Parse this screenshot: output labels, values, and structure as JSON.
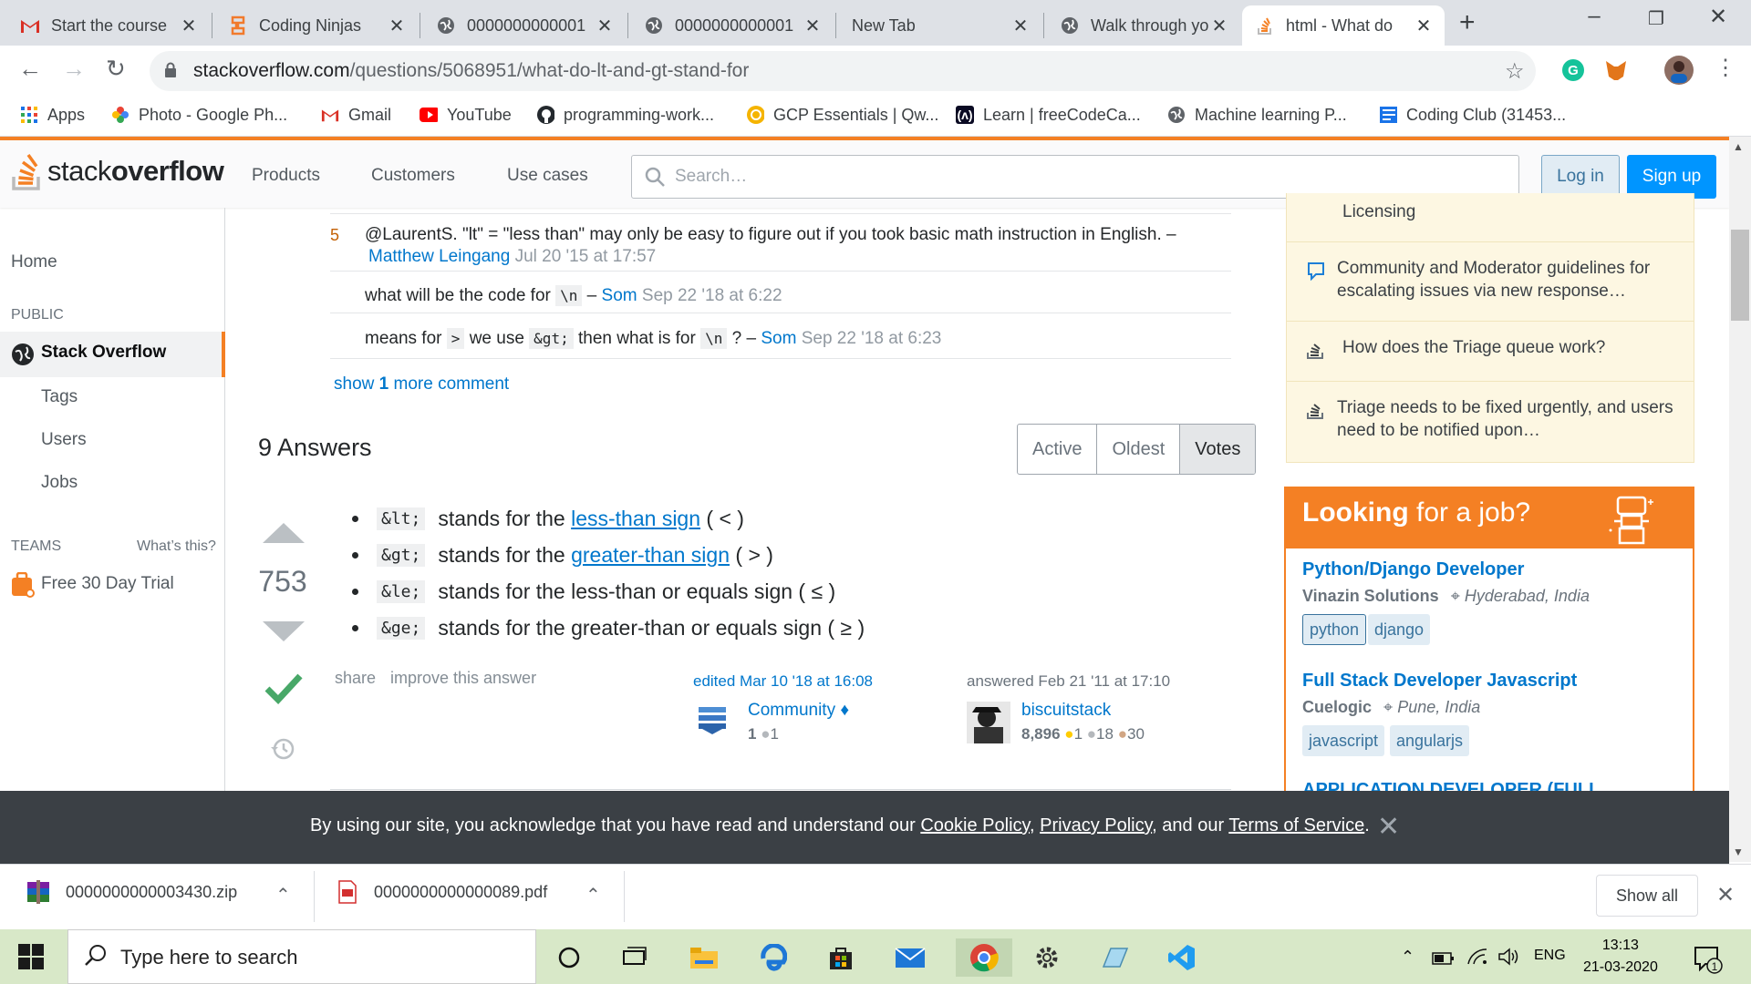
{
  "browser": {
    "tabs": [
      {
        "title": "Start the course",
        "favicon": "gmail-icon"
      },
      {
        "title": "Coding Ninjas",
        "favicon": "coding-ninjas-icon"
      },
      {
        "title": "0000000000001",
        "favicon": "globe-icon"
      },
      {
        "title": "0000000000001",
        "favicon": "globe-icon"
      },
      {
        "title": "New Tab",
        "favicon": "none"
      },
      {
        "title": "Walk through yo",
        "favicon": "globe-icon"
      },
      {
        "title": "html - What do",
        "favicon": "stackoverflow-icon"
      }
    ],
    "active_tab_index": 6,
    "url_host": "stackoverflow.com",
    "url_path": "/questions/5068951/what-do-lt-and-gt-stand-for",
    "bookmarks": [
      {
        "label": "Apps",
        "icon": "apps-grid-icon"
      },
      {
        "label": "Photo - Google Ph...",
        "icon": "google-photos-icon"
      },
      {
        "label": "Gmail",
        "icon": "gmail-icon"
      },
      {
        "label": "YouTube",
        "icon": "youtube-icon"
      },
      {
        "label": "programming-work...",
        "icon": "github-icon"
      },
      {
        "label": "GCP Essentials | Qw...",
        "icon": "qwiklabs-icon"
      },
      {
        "label": "Learn | freeCodeCa...",
        "icon": "freecodecamp-icon"
      },
      {
        "label": "Machine learning P...",
        "icon": "globe-icon"
      },
      {
        "label": "Coding Club (31453...",
        "icon": "classroom-icon"
      }
    ]
  },
  "so_header": {
    "logo_light": "stack",
    "logo_bold": "overflow",
    "nav": [
      "Products",
      "Customers",
      "Use cases"
    ],
    "search_placeholder": "Search…",
    "login": "Log in",
    "signup": "Sign up"
  },
  "left_nav": {
    "home": "Home",
    "public_label": "PUBLIC",
    "stack_overflow": "Stack Overflow",
    "tags": "Tags",
    "users": "Users",
    "jobs": "Jobs",
    "teams_label": "TEAMS",
    "whats_this": "What’s this?",
    "free_trial": "Free 30 Day Trial"
  },
  "comments": [
    {
      "score": "5",
      "text": "@LaurentS. \"lt\" = \"less than\" may only be easy to figure out if you took basic math instruction in English. –",
      "user": "Matthew Leingang",
      "date": "Jul 20 '15 at 17:57"
    },
    {
      "pre": "what will be the code for",
      "code": "\\n",
      "dash": "–",
      "user": "Som",
      "date": "Sep 22 '18 at 6:22"
    },
    {
      "pre": "means for",
      "code1": ">",
      "mid": "we use",
      "code2": "&gt;",
      "mid2": "then what is for",
      "code3": "\\n",
      "post": "? –",
      "user": "Som",
      "date": "Sep 22 '18 at 6:23"
    }
  ],
  "show_more": {
    "pre": "show",
    "count": "1",
    "post": "more comment"
  },
  "answers": {
    "heading": "9 Answers",
    "sort_tabs": [
      "Active",
      "Oldest",
      "Votes"
    ],
    "selected_sort": "Votes"
  },
  "top_answer": {
    "votes": "753",
    "accepted": true,
    "items": [
      {
        "code": "&lt;",
        "pre": "stands for the",
        "link": "less-than sign",
        "post": "( < )"
      },
      {
        "code": "&gt;",
        "pre": "stands for the",
        "link": "greater-than sign",
        "post": "( > )"
      },
      {
        "code": "&le;",
        "pre": "stands for the less-than or equals sign ( ≤ )",
        "link": "",
        "post": ""
      },
      {
        "code": "&ge;",
        "pre": "stands for the greater-than or equals sign ( ≥ )",
        "link": "",
        "post": ""
      }
    ],
    "share": "share",
    "improve": "improve this answer",
    "edited": {
      "label": "edited Mar 10 '18 at 16:08",
      "user": "Community",
      "diamond": "♦",
      "rep": "1",
      "badge": "1"
    },
    "answered": {
      "label": "answered Feb 21 '11 at 17:10",
      "user": "biscuitstack",
      "rep": "8,896",
      "gold": "1",
      "silver": "18",
      "bronze": "30"
    }
  },
  "sidebar": {
    "partial_top": "Licensing",
    "meta_items": [
      {
        "text": "Community and Moderator guidelines for escalating issues via new response…",
        "icon": "chat-bubble-icon"
      },
      {
        "text": "How does the Triage queue work?",
        "icon": "stack-icon"
      },
      {
        "text": "Triage needs to be fixed urgently, and users need to be notified upon…",
        "icon": "stack-icon"
      }
    ],
    "jobs_title_bold": "Looking",
    "jobs_title_rest": " for a job?",
    "jobs": [
      {
        "title": "Python/Django Developer",
        "company": "Vinazin Solutions",
        "location": "Hyderabad, India",
        "tags": [
          "python",
          "django"
        ]
      },
      {
        "title": "Full Stack Developer Javascript",
        "company": "Cuelogic",
        "location": "Pune, India",
        "tags": [
          "javascript",
          "angularjs"
        ]
      },
      {
        "title": "APPLICATION DEVELOPER (FULL",
        "company": "",
        "location": "",
        "tags": []
      }
    ]
  },
  "cookie_banner": {
    "pre": "By using our site, you acknowledge that you have read and understand our",
    "cookie": "Cookie Policy",
    "comma": ",",
    "privacy": "Privacy Policy",
    "and": ", and our",
    "terms": "Terms of Service",
    "end": "."
  },
  "downloads": [
    {
      "name": "0000000000003430.zip",
      "icon": "winrar-icon"
    },
    {
      "name": "0000000000000089.pdf",
      "icon": "pdf-icon"
    }
  ],
  "downloads_show_all": "Show all",
  "taskbar": {
    "search_placeholder": "Type here to search",
    "lang": "ENG",
    "time": "13:13",
    "date": "21-03-2020",
    "notification_count": "1"
  },
  "colors": {
    "so_orange": "#f48024",
    "so_blue": "#0077cc",
    "accepted_green": "#48a868"
  }
}
